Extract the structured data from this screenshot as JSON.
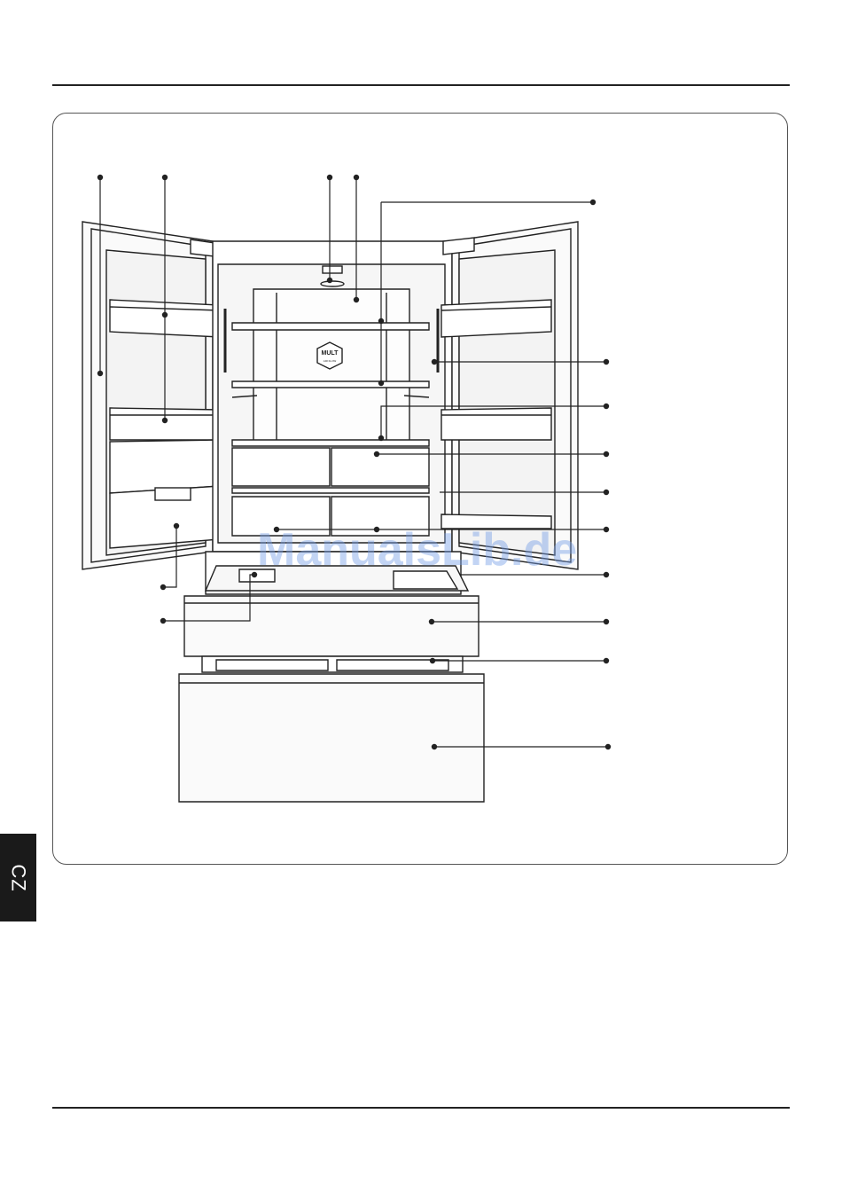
{
  "tab": {
    "language": "CZ"
  },
  "diagram": {
    "badge_text": "MULT",
    "badge_subtext": "AIR FLOW"
  },
  "watermark": "ManualsLib.de",
  "colors": {
    "line": "#222222",
    "frame": "#555555",
    "tab_bg": "#1a1a1a",
    "watermark": "#78a0e6"
  }
}
